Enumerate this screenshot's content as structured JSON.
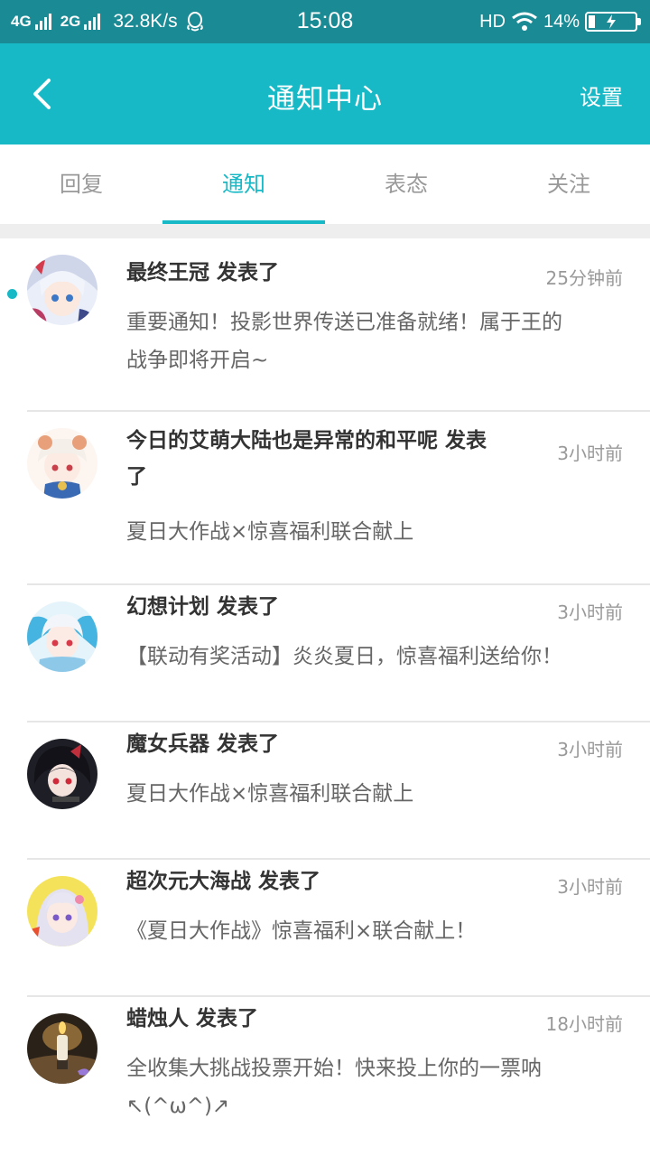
{
  "status_bar": {
    "net1": "4G",
    "net2": "2G",
    "speed": "32.8K/s",
    "time": "15:08",
    "hd": "HD",
    "battery": "14%",
    "battery_level": 0.14
  },
  "header": {
    "title": "通知中心",
    "settings": "设置"
  },
  "tabs": [
    {
      "label": "回复"
    },
    {
      "label": "通知"
    },
    {
      "label": "表态"
    },
    {
      "label": "关注"
    }
  ],
  "active_tab": "通知",
  "colors": {
    "accent": "#17b9c6",
    "status_bar": "#1a8a94"
  },
  "notifications": [
    {
      "title": "最终王冠 发表了",
      "time": "25分钟前",
      "body_line1": "重要通知！投影世界传送已准备就绪！属于王的",
      "body_line2": "战争即将开启~",
      "unread": true
    },
    {
      "title_line1": "今日的艾萌大陆也是异常的和平呢 发表",
      "title_line2": "了",
      "time": "3小时前",
      "body_line1": "夏日大作战×惊喜福利联合献上"
    },
    {
      "title": "幻想计划 发表了",
      "time": "3小时前",
      "body_line1": "【联动有奖活动】炎炎夏日，惊喜福利送给你！"
    },
    {
      "title": "魔女兵器 发表了",
      "time": "3小时前",
      "body_line1": "夏日大作战×惊喜福利联合献上"
    },
    {
      "title": "超次元大海战 发表了",
      "time": "3小时前",
      "body_line1": "《夏日大作战》惊喜福利×联合献上！"
    },
    {
      "title": "蜡烛人 发表了",
      "time": "18小时前",
      "body_line1": "全收集大挑战投票开始！快来投上你的一票呐",
      "body_line2": "↖(^ω^)↗"
    }
  ]
}
